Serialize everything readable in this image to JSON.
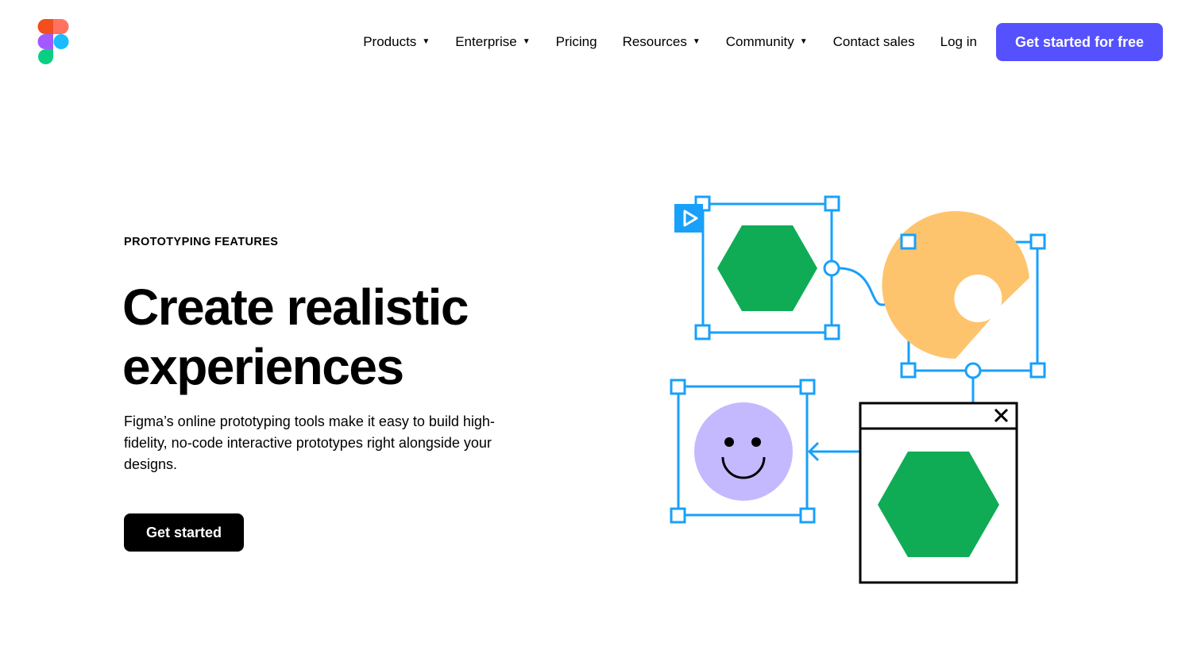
{
  "header": {
    "logo_icon": "figma-logo-icon",
    "nav": [
      {
        "label": "Products",
        "has_dropdown": true
      },
      {
        "label": "Enterprise",
        "has_dropdown": true
      },
      {
        "label": "Pricing",
        "has_dropdown": false
      },
      {
        "label": "Resources",
        "has_dropdown": true
      },
      {
        "label": "Community",
        "has_dropdown": true
      },
      {
        "label": "Contact sales",
        "has_dropdown": false
      }
    ],
    "login_label": "Log in",
    "cta_label": "Get started for free",
    "dropdown_glyph": "▼"
  },
  "hero": {
    "eyebrow": "PROTOTYPING FEATURES",
    "headline_line1": "Create realistic",
    "headline_line2": "experiences",
    "body": "Figma’s online prototyping tools make it easy to build high-fidelity, no-code interactive prototypes right alongside your designs.",
    "cta_label": "Get started"
  },
  "colors": {
    "accent_purple": "#5551ff",
    "frame_blue": "#18a0fb",
    "hexagon_green": "#0fac55",
    "pacman_yellow": "#fec46d",
    "smiley_lavender": "#c4b9ff",
    "black": "#000000"
  },
  "illustration": {
    "icons": [
      "play-icon",
      "close-icon",
      "hexagon-shape",
      "pacman-shape",
      "smiley-face",
      "hexagon-shape"
    ]
  }
}
